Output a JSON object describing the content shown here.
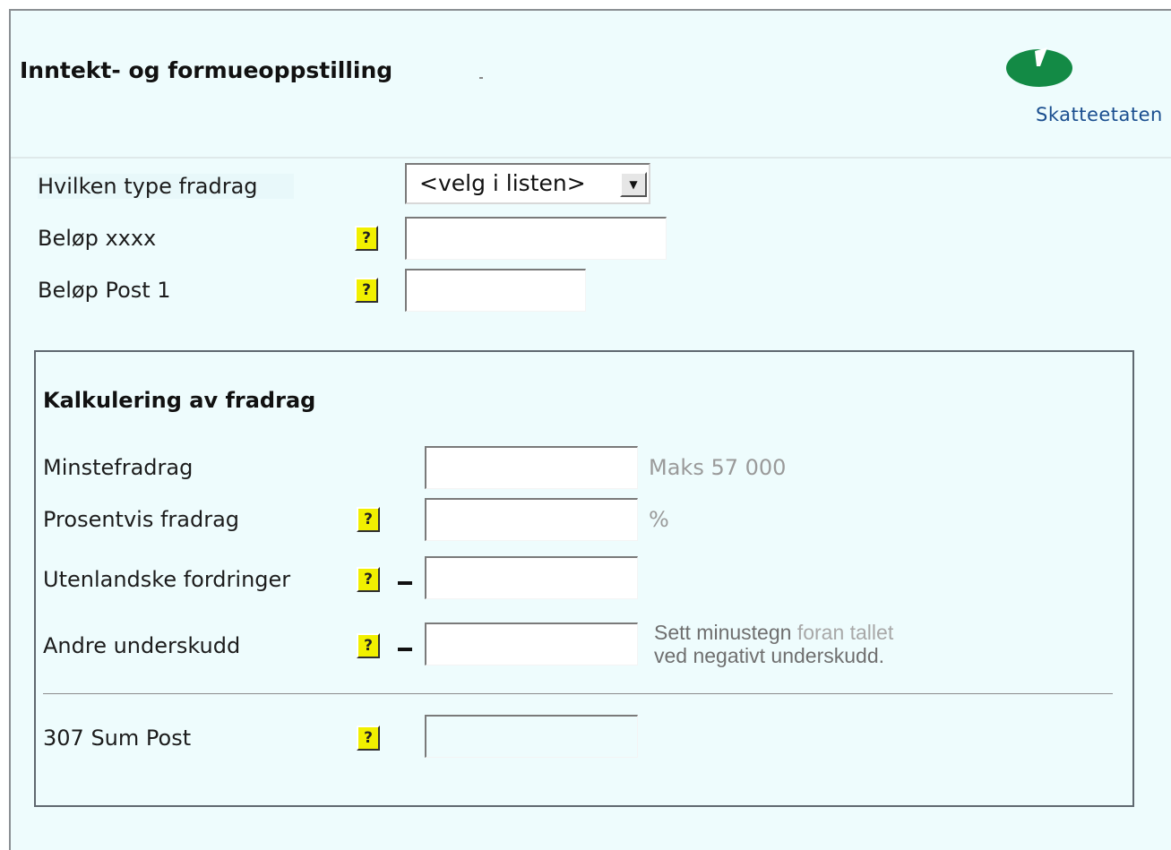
{
  "header": {
    "title": "Inntekt- og formueoppstilling",
    "brand": "Skatteetaten",
    "brand_color": "#1a4e8f",
    "logo_color": "#138a45"
  },
  "top_fields": {
    "deduction_type_label": "Hvilken type fradrag",
    "deduction_type_selected": "<velg i listen>",
    "amount_xxxx_label": "Beløp xxxx",
    "amount_post1_label": "Beløp Post 1",
    "help_symbol": "?"
  },
  "calc": {
    "title": "Kalkulering av fradrag",
    "minstefradrag_label": "Minstefradrag",
    "minstefradrag_hint": "Maks 57 000",
    "prosent_label": "Prosentvis fradrag",
    "prosent_hint": "%",
    "utenlandske_label": "Utenlandske fordringer",
    "andre_label": "Andre underskudd",
    "andre_hint_line1_a": "Sett minustegn",
    "andre_hint_line1_b": "foran tallet",
    "andre_hint_line2": "ved negativt underskudd.",
    "sum_label": "307 Sum Post"
  },
  "colors": {
    "panel_bg": "#eefcfd",
    "help_bg": "#f1f000"
  }
}
